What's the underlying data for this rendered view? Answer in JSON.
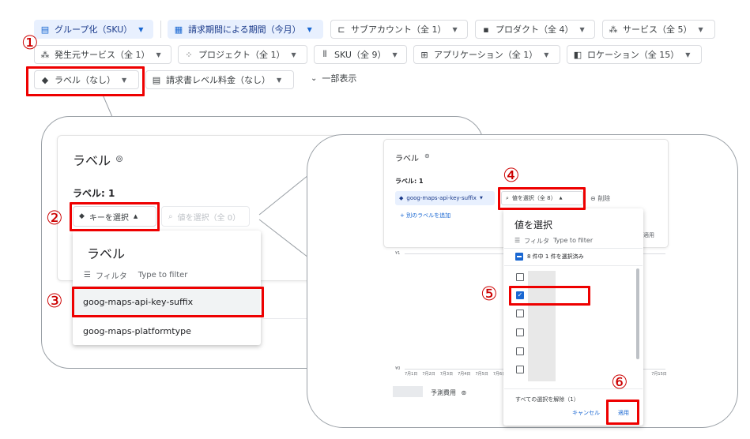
{
  "filters": {
    "row1": [
      {
        "icon": "grid-icon",
        "glyph": "▤",
        "label": "グループ化（SKU）",
        "highlighted": true
      },
      {
        "icon": "calendar-icon",
        "glyph": "▦",
        "label": "請求期間による期間（今月）",
        "highlighted": true
      },
      {
        "icon": "subaccount-icon",
        "glyph": "⊏",
        "label": "サブアカウント（全 1）",
        "highlighted": false
      },
      {
        "icon": "product-icon",
        "glyph": "▪▪",
        "label": "プロダクト（全 4）",
        "highlighted": false
      },
      {
        "icon": "service-icon",
        "glyph": "⁂",
        "label": "サービス（全 5）",
        "highlighted": false
      }
    ],
    "row2": [
      {
        "icon": "source-service-icon",
        "glyph": "⁂",
        "label": "発生元サービス（全 1）"
      },
      {
        "icon": "project-icon",
        "glyph": "⁘",
        "label": "プロジェクト（全 1）"
      },
      {
        "icon": "sku-icon",
        "glyph": "|||",
        "label": "SKU（全 9）"
      },
      {
        "icon": "application-icon",
        "glyph": "⊞",
        "label": "アプリケーション（全 1）"
      },
      {
        "icon": "location-icon",
        "glyph": "◧",
        "label": "ロケーション（全 15）"
      }
    ],
    "row3": [
      {
        "icon": "label-tag-icon",
        "glyph": "◆",
        "label": "ラベル（なし）"
      },
      {
        "icon": "invoice-icon",
        "glyph": "▤",
        "label": "請求書レベル料金（なし）"
      }
    ],
    "partial_display": "一部表示"
  },
  "callouts": [
    "①",
    "②",
    "③",
    "④",
    "⑤",
    "⑥"
  ],
  "left_panel": {
    "title": "ラベル",
    "count_label": "ラベル: 1",
    "key_select": "キーを選択",
    "value_select": "値を選択（全 0）",
    "dropdown": {
      "title": "ラベル",
      "filter": "フィルタ",
      "filter_placeholder": "Type to filter",
      "items": [
        "goog-maps-api-key-suffix",
        "goog-maps-platformtype"
      ]
    }
  },
  "right_panel": {
    "title": "ラベル",
    "count_label": "ラベル: 1",
    "key_chip": "goog-maps-api-key-suffix",
    "value_select": "値を選択（全 8）",
    "delete": "削除",
    "add_label": "+ 別のラベルを追加",
    "apply_hint": "適用",
    "y_top": "¥1",
    "y_bottom": "¥0",
    "x_ticks": [
      "7月1日",
      "7月2日",
      "7月3日",
      "7月4日",
      "7月5日",
      "7月6日",
      "7月15日"
    ],
    "legend": "予測費用",
    "dropdown": {
      "title": "値を選択",
      "filter": "フィルタ",
      "filter_placeholder": "Type to filter",
      "summary": "8 件中 1 件を選択済み",
      "clear_all": "すべての選択を解除（1）",
      "cancel": "キャンセル",
      "apply": "適用"
    }
  }
}
